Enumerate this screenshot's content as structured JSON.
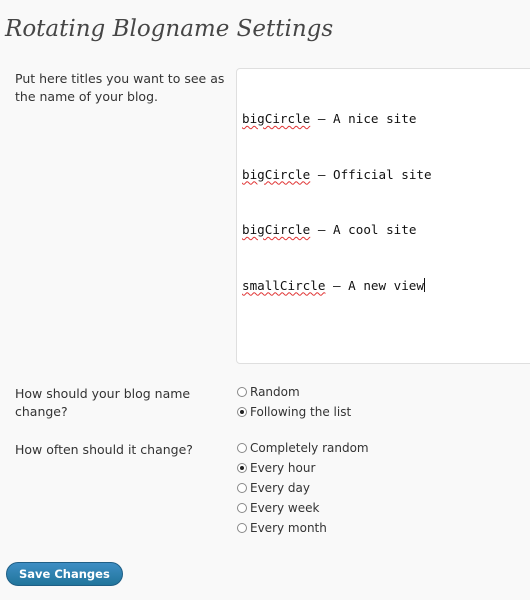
{
  "page": {
    "title": "Rotating Blogname Settings"
  },
  "titles_field": {
    "label": "Put here titles you want to see as the name of your blog.",
    "lines": [
      {
        "name": "bigCircle",
        "rest": " – A nice site"
      },
      {
        "name": "bigCircle",
        "rest": " – Official site"
      },
      {
        "name": "bigCircle",
        "rest": " – A cool site"
      },
      {
        "name": "smallCircle",
        "rest": " – A new view"
      }
    ]
  },
  "change_mode": {
    "label": "How should your blog name change?",
    "options": [
      {
        "label": "Random",
        "checked": false
      },
      {
        "label": "Following the list",
        "checked": true
      }
    ]
  },
  "change_frequency": {
    "label": "How often should it change?",
    "options": [
      {
        "label": "Completely random",
        "checked": false
      },
      {
        "label": "Every hour",
        "checked": true
      },
      {
        "label": "Every day",
        "checked": false
      },
      {
        "label": "Every week",
        "checked": false
      },
      {
        "label": "Every month",
        "checked": false
      }
    ]
  },
  "save_button": {
    "label": "Save Changes"
  },
  "colors": {
    "accent": "#21759b",
    "spellcheck_underline": "#e03333"
  }
}
